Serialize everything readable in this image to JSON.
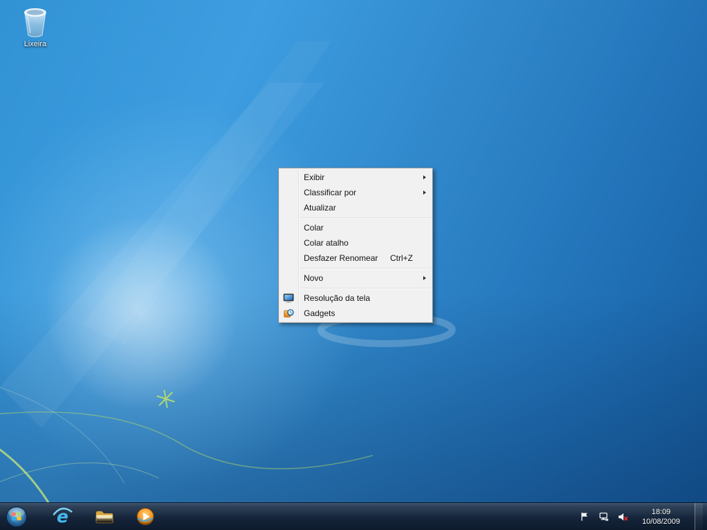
{
  "desktop": {
    "recycle_bin_label": "Lixeira"
  },
  "context_menu": {
    "items": {
      "exibir": "Exibir",
      "classificar_por": "Classificar por",
      "atualizar": "Atualizar",
      "colar": "Colar",
      "colar_atalho": "Colar atalho",
      "desfazer_renomear": "Desfazer Renomear",
      "desfazer_shortcut": "Ctrl+Z",
      "novo": "Novo",
      "resolucao_da_tela": "Resolução da tela",
      "gadgets": "Gadgets"
    }
  },
  "taskbar": {
    "clock_time": "18:09",
    "clock_date": "10/08/2009"
  },
  "icons": {
    "desktop": [
      "recycle-bin-icon"
    ],
    "menu": [
      "display-resolution-icon",
      "gadgets-icon"
    ],
    "taskbar": [
      "start-orb-icon",
      "internet-explorer-icon",
      "windows-explorer-icon",
      "media-player-icon"
    ],
    "tray": [
      "action-center-flag-icon",
      "network-icon",
      "volume-muted-icon"
    ]
  },
  "colors": {
    "wallpaper_top": "#3192d4",
    "wallpaper_bottom": "#155a9b",
    "wallpaper_flare": "#ffffff",
    "accent_green": "#b5dc66",
    "menu_bg": "#f1f1f1",
    "menu_border": "#9b9b9b",
    "taskbar_bg": "#15243a",
    "text_on_desktop": "#ffffff"
  }
}
